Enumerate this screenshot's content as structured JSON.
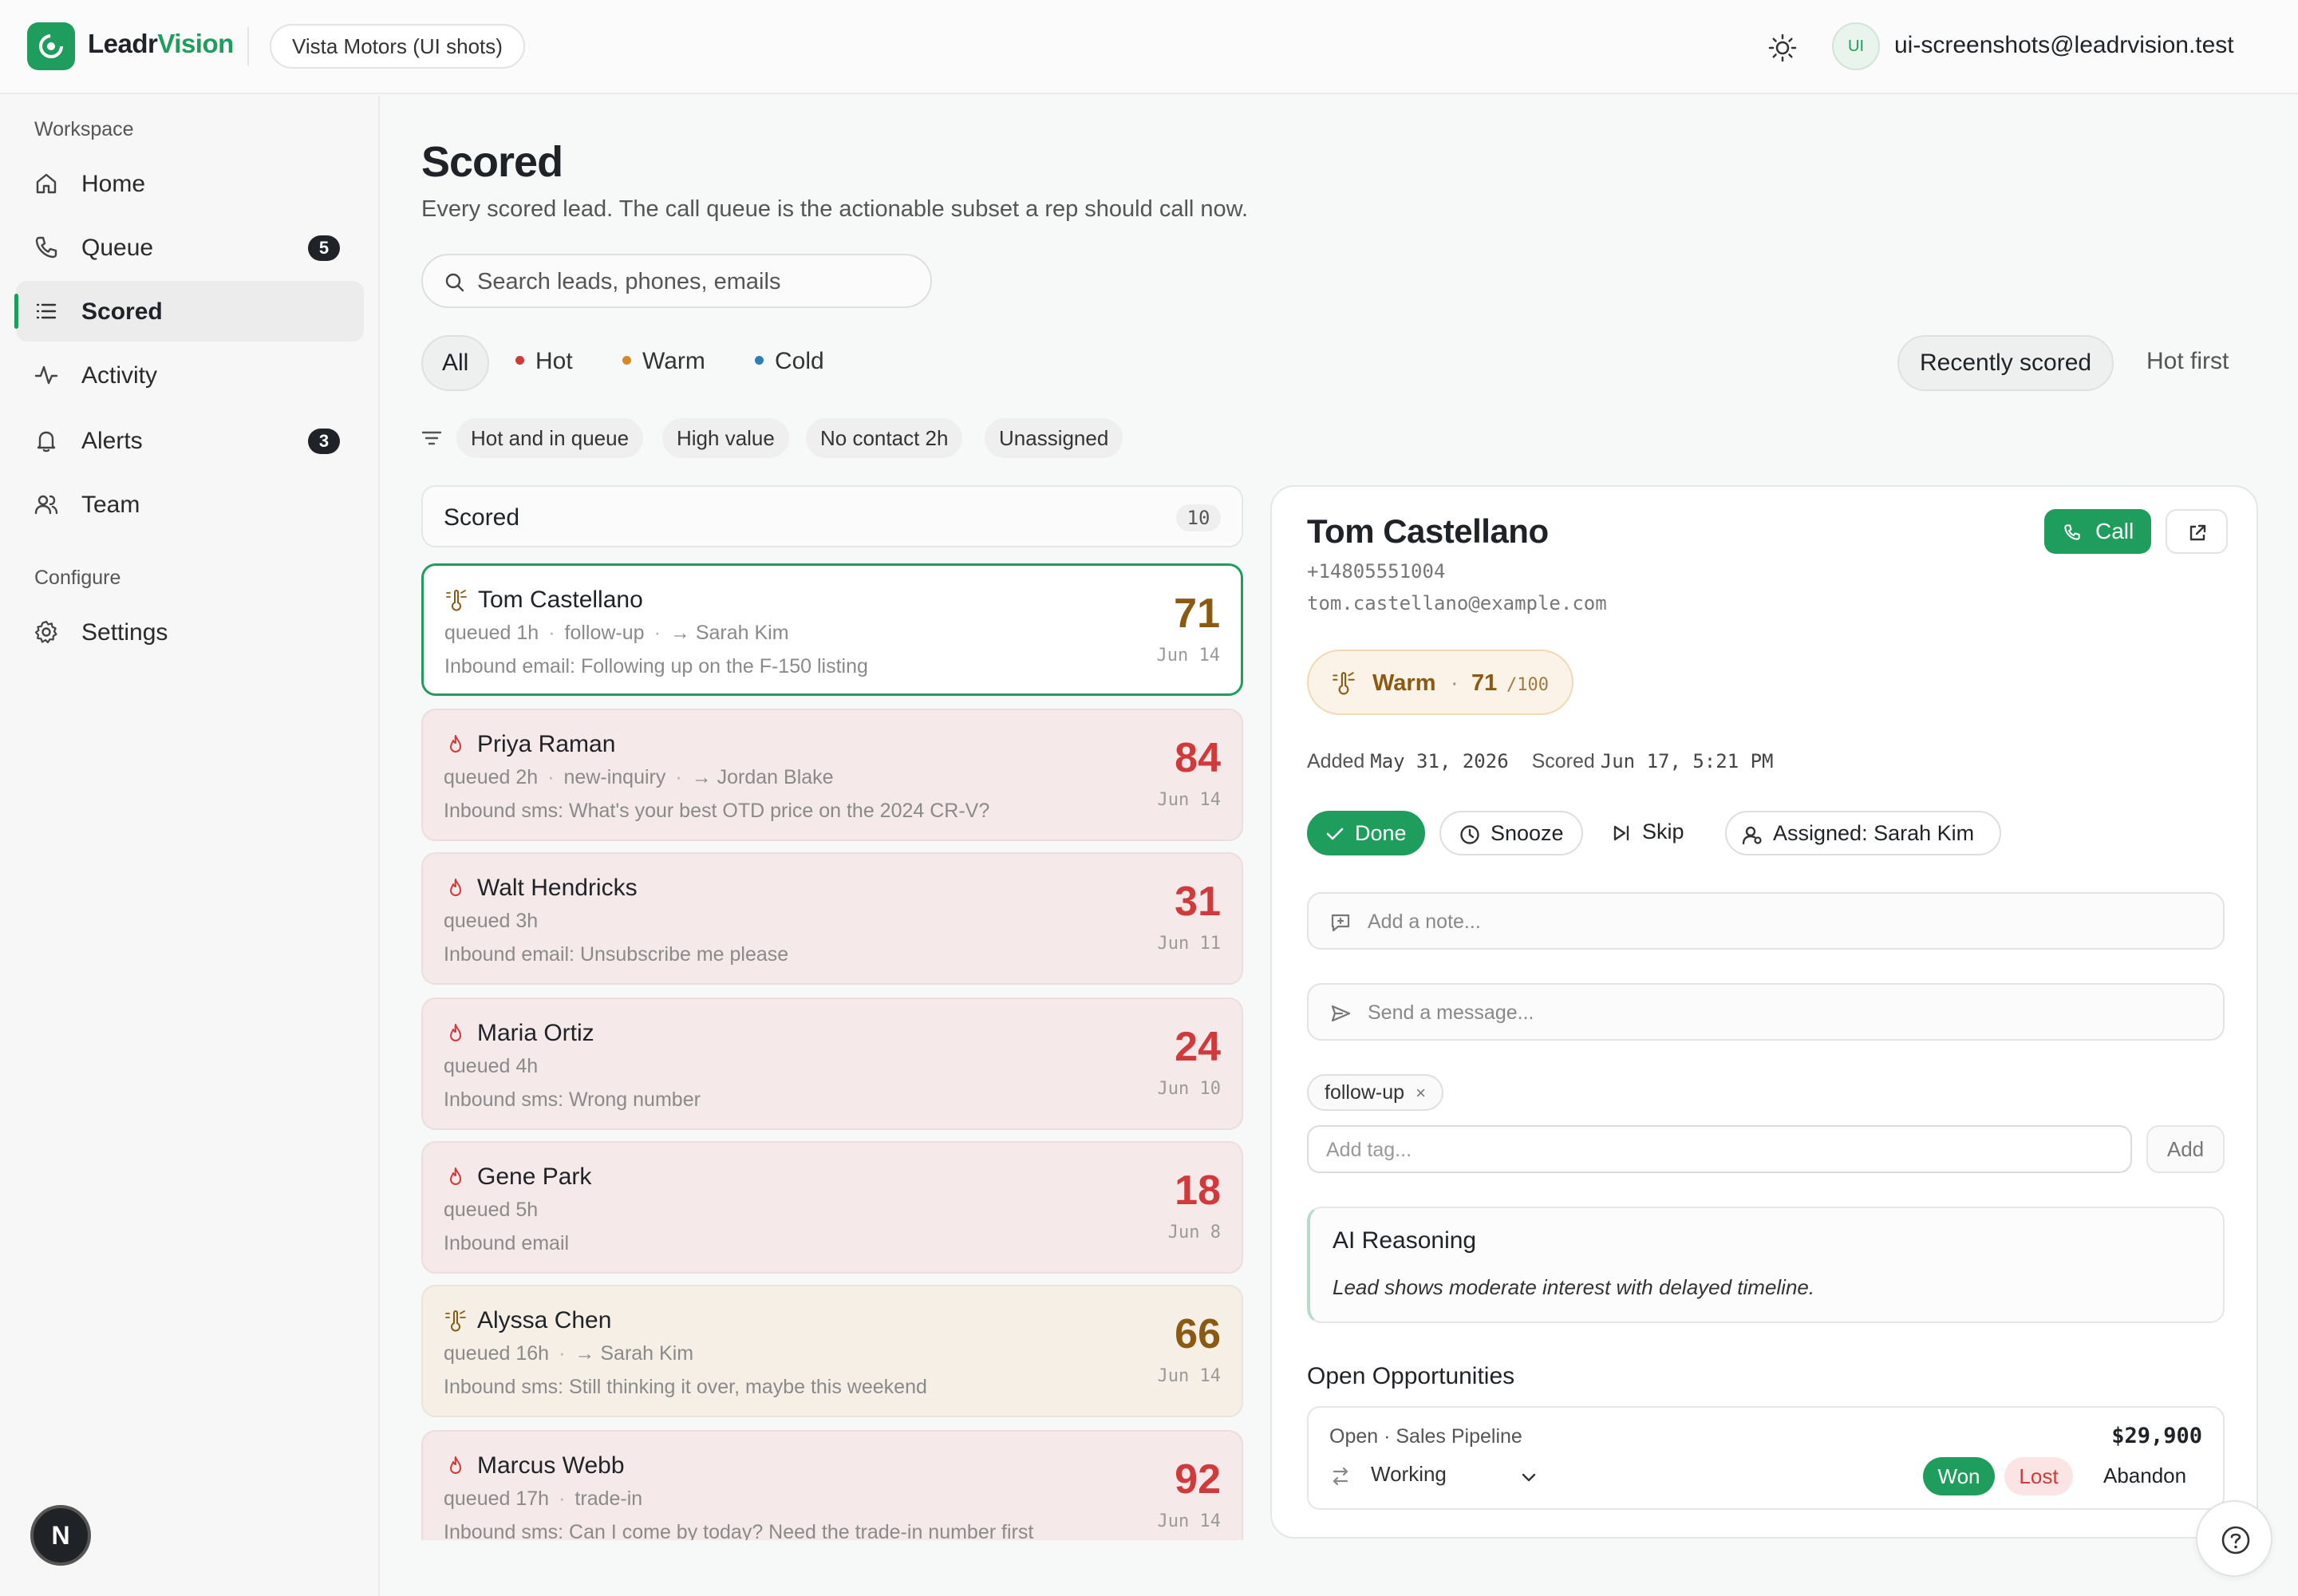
{
  "app": {
    "brand_a": "Leadr",
    "brand_b": "Vision",
    "org": "Vista Motors (UI shots)",
    "user_initials": "UI",
    "user_email": "ui-screenshots@leadrvision.test",
    "accent": "#1f9d5c"
  },
  "sidebar": {
    "workspace_label": "Workspace",
    "configure_label": "Configure",
    "items": [
      {
        "label": "Home",
        "icon": "home-icon"
      },
      {
        "label": "Queue",
        "icon": "phone-icon",
        "badge": "5"
      },
      {
        "label": "Scored",
        "icon": "list-icon",
        "active": true
      },
      {
        "label": "Activity",
        "icon": "activity-icon"
      },
      {
        "label": "Alerts",
        "icon": "bell-icon",
        "badge": "3"
      },
      {
        "label": "Team",
        "icon": "users-icon"
      }
    ],
    "configure_items": [
      {
        "label": "Settings",
        "icon": "gear-icon"
      }
    ],
    "n_button": "N"
  },
  "page": {
    "title": "Scored",
    "subtitle": "Every scored lead. The call queue is the actionable subset a rep should call now.",
    "search_placeholder": "Search leads, phones, emails"
  },
  "filters": {
    "segments": [
      {
        "label": "All",
        "active": true
      },
      {
        "label": "Hot",
        "color": "#d03a3a"
      },
      {
        "label": "Warm",
        "color": "#d88a2a"
      },
      {
        "label": "Cold",
        "color": "#2a7fb8"
      }
    ],
    "sort": [
      {
        "label": "Recently scored",
        "active": true
      },
      {
        "label": "Hot first"
      }
    ],
    "chips": [
      "Hot and in queue",
      "High value",
      "No contact 2h",
      "Unassigned"
    ]
  },
  "list": {
    "title": "Scored",
    "count": "10",
    "cards": [
      {
        "name": "Tom Castellano",
        "temp": "warm",
        "meta": [
          "queued 1h",
          "follow-up",
          "→ Sarah Kim"
        ],
        "msg": "Inbound email: Following up on the F-150 listing",
        "score": "71",
        "date": "Jun 14",
        "selected": true
      },
      {
        "name": "Priya Raman",
        "temp": "hot",
        "meta": [
          "queued 2h",
          "new-inquiry",
          "→ Jordan Blake"
        ],
        "msg": "Inbound sms: What's your best OTD price on the 2024 CR-V?",
        "score": "84",
        "date": "Jun 14"
      },
      {
        "name": "Walt Hendricks",
        "temp": "hot",
        "meta": [
          "queued 3h"
        ],
        "msg": "Inbound email: Unsubscribe me please",
        "score": "31",
        "date": "Jun 11"
      },
      {
        "name": "Maria Ortiz",
        "temp": "hot",
        "meta": [
          "queued 4h"
        ],
        "msg": "Inbound sms: Wrong number",
        "score": "24",
        "date": "Jun 10"
      },
      {
        "name": "Gene Park",
        "temp": "hot",
        "meta": [
          "queued 5h"
        ],
        "msg": "Inbound email",
        "score": "18",
        "date": "Jun 8"
      },
      {
        "name": "Alyssa Chen",
        "temp": "warm",
        "meta": [
          "queued 16h",
          "→ Sarah Kim"
        ],
        "msg": "Inbound sms: Still thinking it over, maybe this weekend",
        "score": "66",
        "date": "Jun 14"
      },
      {
        "name": "Marcus Webb",
        "temp": "hot",
        "meta": [
          "queued 17h",
          "trade-in"
        ],
        "msg": "Inbound sms: Can I come by today? Need the trade-in number first",
        "score": "92",
        "date": "Jun 14"
      }
    ]
  },
  "detail": {
    "name": "Tom Castellano",
    "phone": "+14805551004",
    "email": "tom.castellano@example.com",
    "call_label": "Call",
    "temp_label": "Warm",
    "temp_sep": "·",
    "score": "71",
    "score_of": "/100",
    "added_label": "Added",
    "added_value": "May 31, 2026",
    "scored_label": "Scored",
    "scored_value": "Jun 17, 5:21 PM",
    "actions": {
      "done": "Done",
      "snooze": "Snooze",
      "skip": "Skip",
      "assigned": "Assigned: Sarah Kim"
    },
    "note_placeholder": "Add a note...",
    "message_placeholder": "Send a message...",
    "tag": "follow-up",
    "tag_remove": "×",
    "tag_placeholder": "Add tag...",
    "tag_add": "Add",
    "ai_title": "AI Reasoning",
    "ai_text": "Lead shows moderate interest with delayed timeline.",
    "opp_title": "Open Opportunities",
    "opp_status": "Open · Sales Pipeline",
    "opp_amount": "$29,900",
    "opp_stage": "Working",
    "won": "Won",
    "lost": "Lost",
    "abandon": "Abandon"
  }
}
